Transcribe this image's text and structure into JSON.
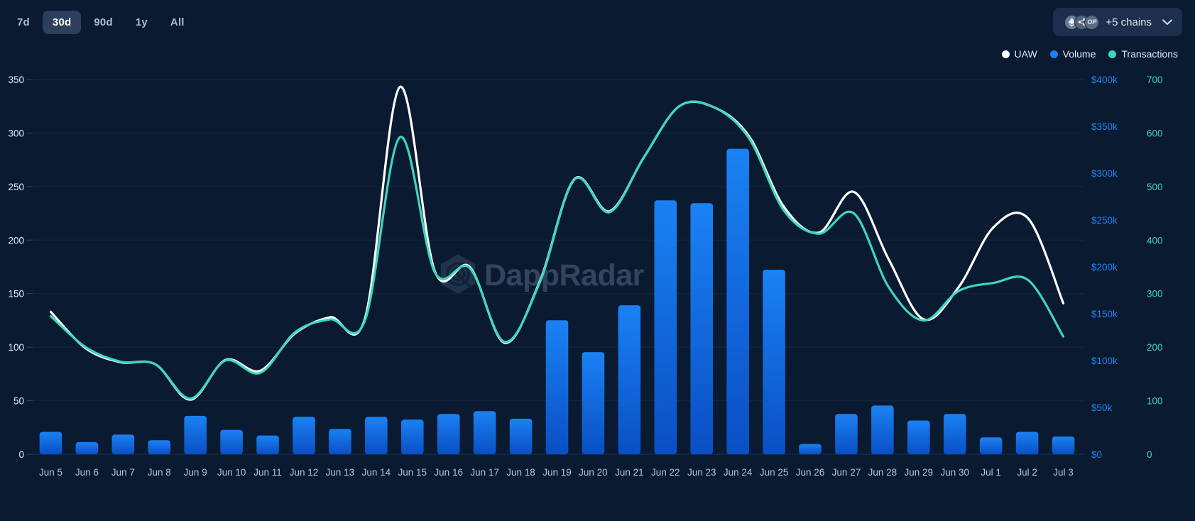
{
  "toolbar": {
    "ranges": [
      {
        "label": "7d",
        "active": false
      },
      {
        "label": "30d",
        "active": true
      },
      {
        "label": "90d",
        "active": false
      },
      {
        "label": "1y",
        "active": false
      },
      {
        "label": "All",
        "active": false
      }
    ],
    "chain_selector": {
      "label": "+5 chains",
      "chevron_icon": "chevron-down-icon",
      "icons": [
        "ethereum-icon",
        "node-chain-icon",
        "optimism-icon"
      ],
      "optimism_text": "OP"
    }
  },
  "legend": [
    {
      "label": "UAW",
      "color": "#ffffff"
    },
    {
      "label": "Volume",
      "color": "#1283f0"
    },
    {
      "label": "Transactions",
      "color": "#3dd6bd"
    }
  ],
  "watermark": {
    "text": "DappRadar",
    "logo_icon": "dappradar-hexagon-logo-icon"
  },
  "chart_data": {
    "type": "bar",
    "title": "",
    "xlabel": "",
    "grid": true,
    "legend_position": "top-right",
    "categories": [
      "Jun 5",
      "Jun 6",
      "Jun 7",
      "Jun 8",
      "Jun 9",
      "Jun 10",
      "Jun 11",
      "Jun 12",
      "Jun 13",
      "Jun 14",
      "Jun 15",
      "Jun 16",
      "Jun 17",
      "Jun 18",
      "Jun 19",
      "Jun 20",
      "Jun 21",
      "Jun 22",
      "Jun 23",
      "Jun 24",
      "Jun 25",
      "Jun 26",
      "Jun 27",
      "Jun 28",
      "Jun 29",
      "Jun 30",
      "Jul 1",
      "Jul 2",
      "Jul 3"
    ],
    "axes": {
      "left": {
        "name": "UAW",
        "color": "#e9eef6",
        "min": 0,
        "max": 350,
        "ticks": [
          0,
          50,
          100,
          150,
          200,
          250,
          300,
          350
        ],
        "tick_labels": [
          "0",
          "50",
          "100",
          "150",
          "200",
          "250",
          "300",
          "350"
        ]
      },
      "right_inner": {
        "name": "Volume",
        "color": "#1f86f0",
        "min": 0,
        "max": 400000,
        "ticks": [
          0,
          50000,
          100000,
          150000,
          200000,
          250000,
          300000,
          350000,
          400000
        ],
        "tick_labels": [
          "$0",
          "$50k",
          "$100k",
          "$150k",
          "$200k",
          "$250k",
          "$300k",
          "$350k",
          "$400k"
        ]
      },
      "right_outer": {
        "name": "Transactions",
        "color": "#3dd6bd",
        "min": 0,
        "max": 700,
        "ticks": [
          0,
          100,
          200,
          300,
          400,
          500,
          600,
          700
        ],
        "tick_labels": [
          "0",
          "100",
          "200",
          "300",
          "400",
          "500",
          "600",
          "700"
        ]
      }
    },
    "series": [
      {
        "name": "Volume",
        "type": "bar",
        "axis": "right_inner",
        "color": "#1283f0",
        "unit": "USD",
        "values": [
          24000,
          13000,
          21000,
          15000,
          41000,
          26000,
          20000,
          40000,
          27000,
          40000,
          37000,
          43000,
          46000,
          38000,
          143000,
          109000,
          159000,
          271000,
          268000,
          326000,
          197000,
          11000,
          43000,
          52000,
          36000,
          43000,
          18000,
          24000,
          19000
        ]
      },
      {
        "name": "UAW",
        "type": "line",
        "axis": "left",
        "color": "#ffffff",
        "values": [
          133,
          99,
          86,
          84,
          51,
          88,
          78,
          113,
          128,
          127,
          343,
          171,
          175,
          104,
          161,
          257,
          227,
          278,
          325,
          324,
          297,
          231,
          207,
          245,
          182,
          126,
          156,
          212,
          220,
          141
        ]
      },
      {
        "name": "Transactions",
        "type": "line",
        "axis": "right_outer",
        "color": "#3dd6bd",
        "values": [
          258,
          200,
          173,
          168,
          104,
          175,
          152,
          228,
          252,
          250,
          592,
          340,
          348,
          210,
          320,
          513,
          452,
          556,
          650,
          648,
          590,
          455,
          412,
          450,
          312,
          250,
          305,
          320,
          325,
          220
        ]
      }
    ]
  }
}
